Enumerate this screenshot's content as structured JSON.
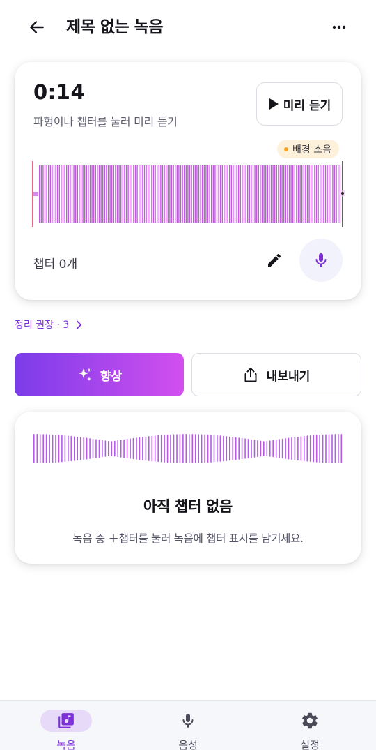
{
  "header": {
    "title": "제목 없는 녹음",
    "back_icon": "arrow-left-icon",
    "more_icon": "more-horizontal-icon"
  },
  "player": {
    "time": "0:14",
    "hint": "파형이나 챕터를 눌러 미리 듣기",
    "preview_label": "미리 듣기",
    "noise_badge": "배경 소음",
    "chapter_count": "챕터 0개",
    "colors": {
      "wave": "#c25ae0",
      "playhead": "#e0406a",
      "accent": "#7d2fd8"
    }
  },
  "suggestion": {
    "label": "정리 권장 · 3"
  },
  "actions": {
    "enhance_label": "향상",
    "export_label": "내보내기"
  },
  "empty_state": {
    "title": "아직 챕터 없음",
    "subtitle": "녹음 중 ＋챕터를 눌러 녹음에 챕터 표시를 남기세요."
  },
  "nav": {
    "items": [
      {
        "label": "녹음",
        "icon": "library-music-icon",
        "active": true
      },
      {
        "label": "음성",
        "icon": "mic-icon",
        "active": false
      },
      {
        "label": "설정",
        "icon": "gear-icon",
        "active": false
      }
    ]
  }
}
